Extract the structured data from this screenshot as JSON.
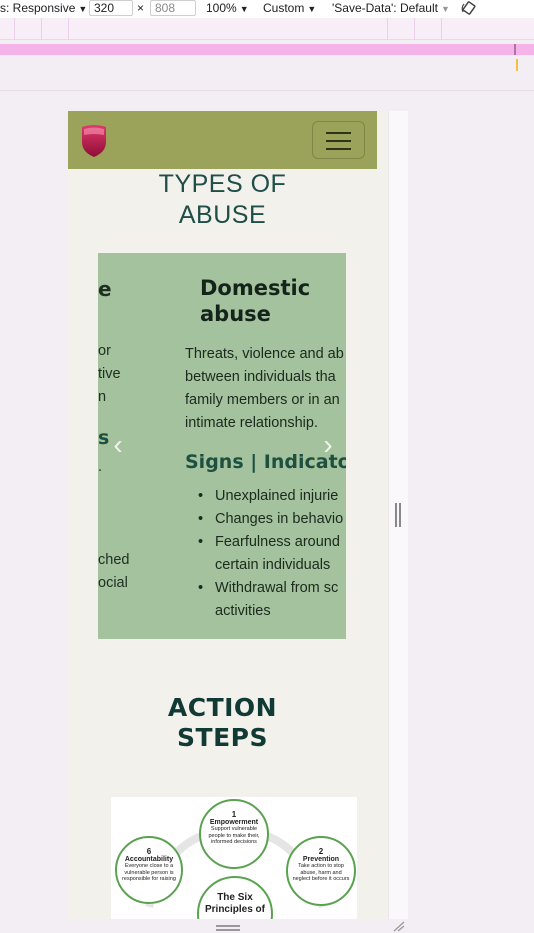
{
  "devtools": {
    "device": "s: Responsive",
    "width": "320",
    "times": "×",
    "height_placeholder": "808",
    "zoom": "100%",
    "throttle": "Custom",
    "save_data": "'Save-Data': Default"
  },
  "page": {
    "types_title_line1": "TYPES OF",
    "types_title_line2": "ABUSE",
    "prev_slide": {
      "line1": "e",
      "line2": "or",
      "line3": "tive",
      "line4": "n",
      "line5": "s",
      "line6": ".",
      "line7": "ched",
      "line8": "ocial"
    },
    "slide": {
      "heading_line1": "Domestic",
      "heading_line2": "abuse",
      "desc_line1": "Threats, violence and ab",
      "desc_line2": "between individuals tha",
      "desc_line3": "family members or in an",
      "desc_line4": "intimate relationship.",
      "signs": "Signs | Indicator",
      "items": [
        {
          "line1": "Unexplained injurie"
        },
        {
          "line1": "Changes in behavio"
        },
        {
          "line1": "Fearfulness around",
          "line2": "certain individuals"
        },
        {
          "line1": "Withdrawal from sc",
          "line2": "activities"
        }
      ]
    },
    "arrows": {
      "prev": "‹",
      "next": "›"
    },
    "action_title_line1": "ACTION",
    "action_title_line2": "STEPS",
    "principles": {
      "p1": {
        "num": "1",
        "name": "Empowerment",
        "desc": "Support vulnerable people to make their, informed decisions"
      },
      "p2": {
        "num": "2",
        "name": "Prevention",
        "desc": "Take action to stop abuse, harm and neglect before it occurs"
      },
      "p6": {
        "num": "6",
        "name": "Accountability",
        "desc": "Everyone close to a vulnerable person is responsible for raising"
      },
      "center_line1": "The Six",
      "center_line2": "Principles of"
    }
  },
  "colors": {
    "navbar": "#9ba25a",
    "carousel": "#a3c29d",
    "heading_teal": "#1f4d48",
    "logo_red": "#c0174d",
    "principle_green": "#5aa250"
  },
  "icons": [
    "rotate-icon",
    "shield-logo-icon",
    "hamburger-menu-icon",
    "chevron-left-icon",
    "chevron-right-icon",
    "resize-handle-icon"
  ]
}
